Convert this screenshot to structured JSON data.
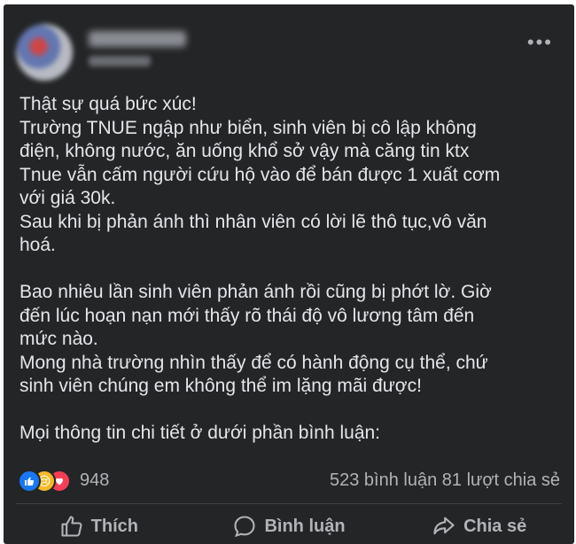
{
  "post": {
    "lines": [
      "Thật sự quá bức xúc!",
      "Trường TNUE ngập như biển, sinh viên bị cô lập không",
      "điện, không nước, ăn uống khổ sở vậy mà căng tin ktx",
      "Tnue vẫn cấm người cứu hộ vào để bán được 1 xuất cơm",
      "với giá 30k.",
      "Sau khi bị phản ánh thì nhân viên có lời lẽ thô tục,vô văn",
      "hoá.",
      "",
      "Bao nhiêu lần sinh viên phản ánh rồi cũng bị phớt lờ. Giờ",
      "đến lúc hoạn nạn mới thấy rõ thái độ vô lương tâm đến",
      "mức nào.",
      "Mong nhà trường nhìn thấy để có hành động cụ thể, chứ",
      "sinh viên chúng em không thể im lặng mãi được!",
      "",
      "Mọi thông tin chi tiết ở dưới phần bình luận:"
    ]
  },
  "stats": {
    "reactions": "948",
    "comments_shares": "523 bình luận  81 lượt chia sẻ"
  },
  "actions": {
    "like": "Thích",
    "comment": "Bình luận",
    "share": "Chia sẻ"
  },
  "icons": [
    "more-options-icon",
    "like-reaction-icon",
    "sad-reaction-icon",
    "love-reaction-icon",
    "thumbs-up-icon",
    "comment-bubble-icon",
    "share-arrow-icon"
  ]
}
